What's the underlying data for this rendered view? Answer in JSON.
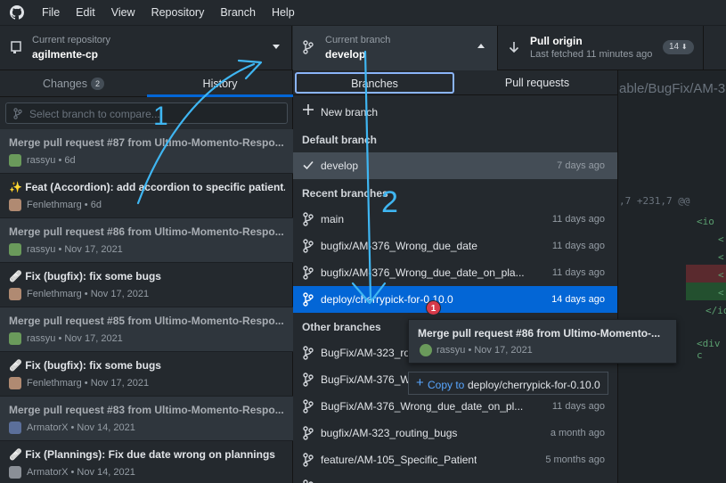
{
  "menubar": {
    "items": [
      "File",
      "Edit",
      "View",
      "Repository",
      "Branch",
      "Help"
    ]
  },
  "toolbar": {
    "repo_label": "Current repository",
    "repo_value": "agilmente-cp",
    "branch_label": "Current branch",
    "branch_value": "develop",
    "pull_label": "Pull origin",
    "pull_sub": "Last fetched 11 minutes ago",
    "pull_count": "14"
  },
  "sidebar": {
    "tab_changes": "Changes",
    "tab_changes_count": "2",
    "tab_history": "History",
    "filter_placeholder": "Select branch to compare...",
    "history": [
      {
        "title": "Merge pull request #87 from Ultimo-Momento-Respo...",
        "meta": "rassyu • 6d",
        "avatar": "#6a9a5b",
        "shade": true,
        "dim": true
      },
      {
        "title": "✨ Feat (Accordion): add accordion to specific patient...",
        "meta": "Fenlethmarg • 6d",
        "avatar": "#b08a72",
        "shade": false,
        "dim": false
      },
      {
        "title": "Merge pull request #86 from Ultimo-Momento-Respo...",
        "meta": "rassyu • Nov 17, 2021",
        "avatar": "#6a9a5b",
        "shade": true,
        "dim": true
      },
      {
        "title": "🩹 Fix (bugfix): fix some bugs",
        "meta": "Fenlethmarg • Nov 17, 2021",
        "avatar": "#b08a72",
        "shade": false,
        "dim": false
      },
      {
        "title": "Merge pull request #85 from Ultimo-Momento-Respo...",
        "meta": "rassyu • Nov 17, 2021",
        "avatar": "#6a9a5b",
        "shade": true,
        "dim": true
      },
      {
        "title": "🩹 Fix (bugfix): fix some bugs",
        "meta": "Fenlethmarg • Nov 17, 2021",
        "avatar": "#b08a72",
        "shade": false,
        "dim": false
      },
      {
        "title": "Merge pull request #83 from Ultimo-Momento-Respo...",
        "meta": "ArmatorX • Nov 14, 2021",
        "avatar": "#5b6f9a",
        "shade": true,
        "dim": true
      },
      {
        "title": "🩹 Fix (Plannings): Fix due date wrong on plannings",
        "meta": "ArmatorX • Nov 14, 2021",
        "avatar": "#8a8f96",
        "shade": false,
        "dim": false
      }
    ]
  },
  "main": {
    "path": "able/BugFix/AM-38",
    "hunk": ",7 +231,7 @@",
    "code_lines": [
      "<io",
      "<",
      "<",
      "<",
      "<",
      "</io",
      "<div c"
    ]
  },
  "dropdown": {
    "tab_branches": "Branches",
    "tab_pulls": "Pull requests",
    "new_branch": "New branch",
    "default_header": "Default branch",
    "default_branch": {
      "name": "develop",
      "age": "7 days ago"
    },
    "recent_header": "Recent branches",
    "recent": [
      {
        "name": "main",
        "age": "11 days ago"
      },
      {
        "name": "bugfix/AM-376_Wrong_due_date",
        "age": "11 days ago"
      },
      {
        "name": "bugfix/AM-376_Wrong_due_date_on_pla...",
        "age": "11 days ago"
      },
      {
        "name": "deploy/cherrypick-for-0.10.0",
        "age": "14 days ago"
      }
    ],
    "other_header": "Other branches",
    "other": [
      {
        "name": "BugFix/AM-323_ro",
        "age": ""
      },
      {
        "name": "BugFix/AM-376_W",
        "age": ""
      },
      {
        "name": "BugFix/AM-376_Wrong_due_date_on_pl...",
        "age": "11 days ago"
      },
      {
        "name": "bugfix/AM-323_routing_bugs",
        "age": "a month ago"
      },
      {
        "name": "feature/AM-105_Specific_Patient",
        "age": "5 months ago"
      }
    ]
  },
  "tooltip": {
    "title": "Merge pull request #86 from Ultimo-Momento-...",
    "meta": "rassyu • Nov 17, 2021",
    "badge": "1",
    "copy_label": "Copy to",
    "copy_branch": "deploy/cherrypick-for-0.10.0"
  },
  "annotations": {
    "label_1": "1",
    "label_2": "2",
    "color": "#3fb6f2"
  }
}
